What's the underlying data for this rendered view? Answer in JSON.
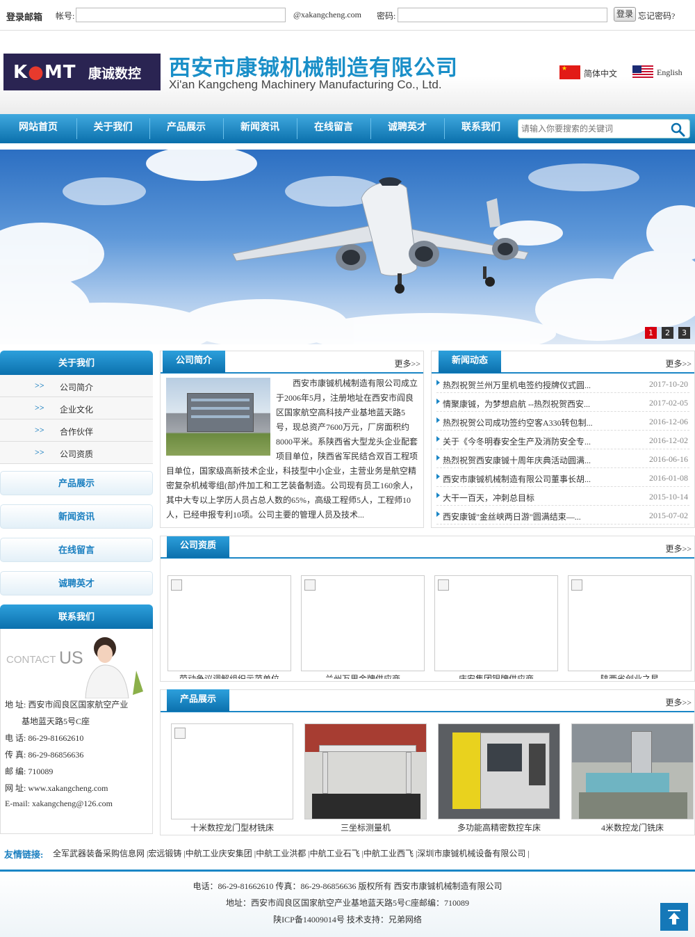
{
  "login": {
    "title": "登录邮箱",
    "account_label": "帐号:",
    "domain": "@xakangcheng.com",
    "password_label": "密码:",
    "login_button": "登录",
    "forgot": "忘记密码?"
  },
  "header": {
    "logo_text_a": "K",
    "logo_text_b": "MT",
    "logo_cn": "康诚数控",
    "company_cn": "西安市康铖机械制造有限公司",
    "company_en": "Xi'an Kangcheng Machinery Manufacturing Co., Ltd.",
    "lang_cn": "简体中文",
    "lang_en": "English"
  },
  "nav": {
    "items": [
      "网站首页",
      "关于我们",
      "产品展示",
      "新闻资讯",
      "在线留言",
      "诚聘英才",
      "联系我们"
    ],
    "search_placeholder": "请输入你要搜索的关键词"
  },
  "banner": {
    "slides": [
      "1",
      "2",
      "3"
    ],
    "active_slide": 1
  },
  "sidebar": {
    "about_title": "关于我们",
    "about_items": [
      "公司简介",
      "企业文化",
      "合作伙伴",
      "公司资质"
    ],
    "arrow": ">>",
    "products": "产品展示",
    "news": "新闻资讯",
    "message": "在线留言",
    "jobs": "诚聘英才",
    "contact_title": "联系我们",
    "contact_art": "CONTACT",
    "contact_art_us": "US",
    "contact_lines": [
      "地  址:  西安市阎良区国家航空产业",
      "基地蓝天路5号C座",
      "电  话:  86-29-81662610",
      "传  真:  86-29-86856636",
      "邮  编:  710089",
      "网  址:  www.xakangcheng.com",
      "E-mail:  xakangcheng@126.com"
    ]
  },
  "intro": {
    "title": "公司简介",
    "more": "更多>>",
    "text": "西安市康铖机械制造有限公司成立于2006年5月，注册地址在西安市阎良区国家航空高科技产业基地蓝天路5号，现总资产7600万元，厂房面积约8000平米。系陕西省大型龙头企业配套项目单位，陕西省军民结合双百工程项目单位，国家级高新技术企业，科技型中小企业，主营业务是航空精密复杂机械零组(部)件加工和工艺装备制造。公司现有员工160余人，其中大专以上学历人员占总人数的65%，高级工程师5人，工程师10人，已经申报专利10项。公司主要的管理人员及技术..."
  },
  "news": {
    "title": "新闻动态",
    "more": "更多>>",
    "items": [
      {
        "title": "热烈祝贺兰州万里机电签约授牌仪式圆...",
        "date": "2017-10-20"
      },
      {
        "title": "情聚康铖，为梦想启航 --热烈祝贺西安...",
        "date": "2017-02-05"
      },
      {
        "title": "热烈祝贺公司成功签约空客A330转包制...",
        "date": "2016-12-06"
      },
      {
        "title": "关于《今冬明春安全生产及消防安全专...",
        "date": "2016-12-02"
      },
      {
        "title": "热烈祝贺西安康铖十周年庆典活动圆满...",
        "date": "2016-06-16"
      },
      {
        "title": "西安市康铖机械制造有限公司董事长胡...",
        "date": "2016-01-08"
      },
      {
        "title": "大干一百天，冲刺总目标",
        "date": "2015-10-14"
      },
      {
        "title": "西安康铖\"金丝峡两日游\"圆满结束—...",
        "date": "2015-07-02"
      }
    ]
  },
  "certs": {
    "title": "公司资质",
    "more": "更多>>",
    "items": [
      "劳动争议调解组织示范单位",
      "兰州万里金牌供应商",
      "庆安集团银牌供应商",
      "陕西省创业之星"
    ]
  },
  "products": {
    "title": "产品展示",
    "more": "更多>>",
    "items": [
      "十米数控龙门型材铣床",
      "三坐标测量机",
      "多功能高精密数控车床",
      "4米数控龙门铣床"
    ]
  },
  "friends": {
    "label": "友情链接:",
    "links": "全军武器装备采购信息网 |宏远锻铸 |中航工业庆安集团 |中航工业洪都 |中航工业石飞 |中航工业西飞 |深圳市康铖机械设备有限公司 |"
  },
  "footer": {
    "line1": "电话：86-29-81662610 传真：86-29-86856636 版权所有 西安市康铖机械制造有限公司",
    "line2": "地址：西安市阎良区国家航空产业基地蓝天路5号C座邮编：710089",
    "line3": "陕ICP备14009014号  技术支持：兄弟网络"
  }
}
